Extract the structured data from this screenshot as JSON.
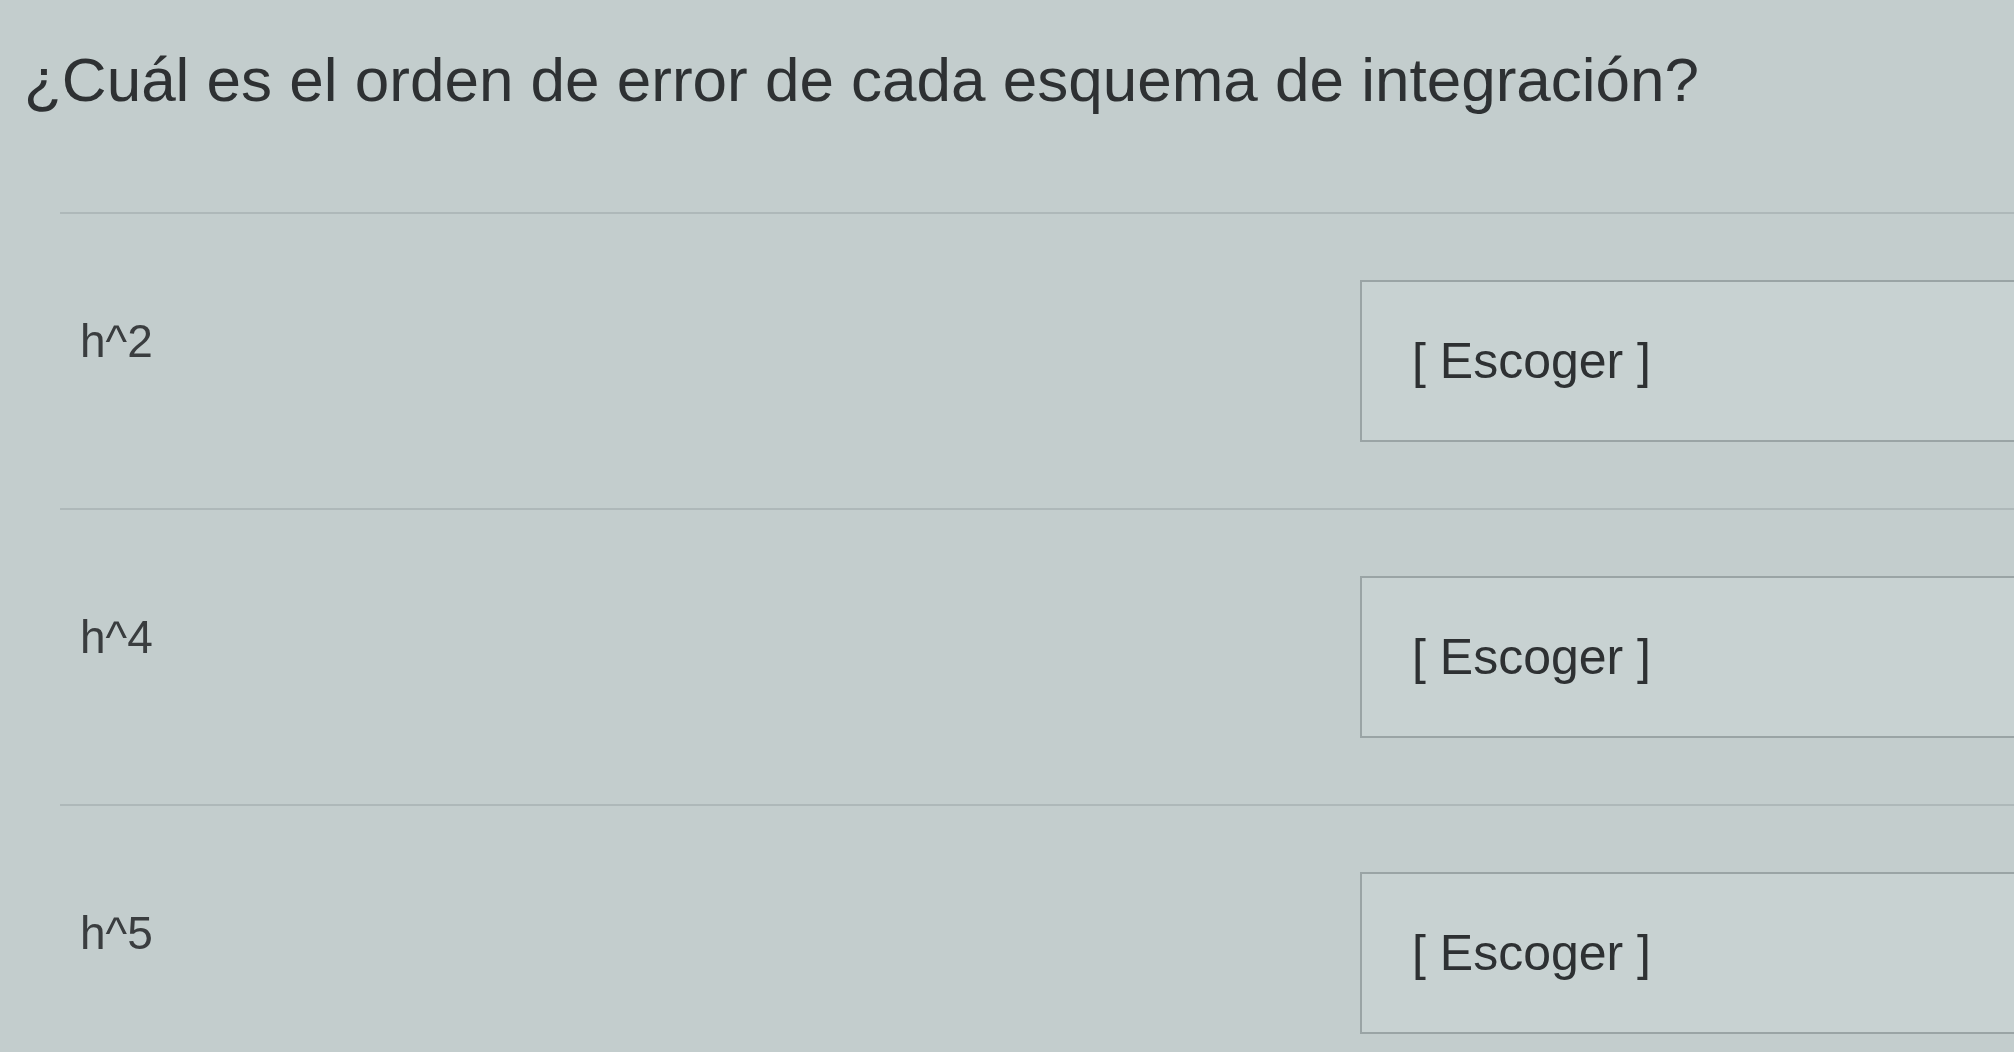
{
  "question": "¿Cuál es el orden de error de cada esquema de integración?",
  "rows": [
    {
      "label": "h^2",
      "answer": "[ Escoger ]"
    },
    {
      "label": "h^4",
      "answer": "[ Escoger ]"
    },
    {
      "label": "h^5",
      "answer": "[ Escoger ]"
    }
  ]
}
